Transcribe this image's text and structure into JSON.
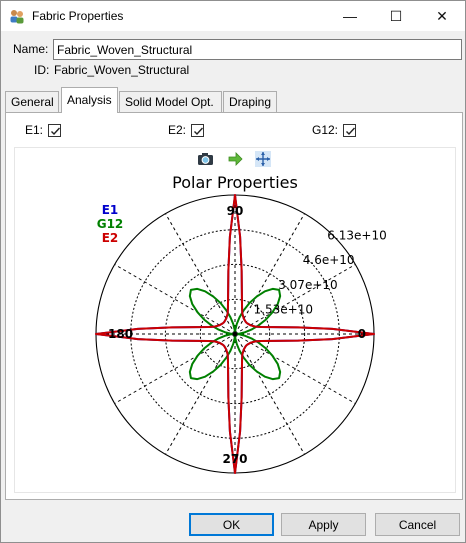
{
  "window": {
    "title": "Fabric Properties",
    "minimize_glyph": "—",
    "maximize_glyph": "☐",
    "close_glyph": "✕"
  },
  "form": {
    "name_label": "Name:",
    "name_value": "Fabric_Woven_Structural",
    "id_label": "ID:",
    "id_value": "Fabric_Woven_Structural"
  },
  "tabs": [
    {
      "label": "General",
      "active": false
    },
    {
      "label": "Analysis",
      "active": true
    },
    {
      "label": "Solid Model Opt.",
      "active": false
    },
    {
      "label": "Draping",
      "active": false
    }
  ],
  "checkboxes": [
    {
      "label": "E1:",
      "checked": true
    },
    {
      "label": "E2:",
      "checked": true
    },
    {
      "label": "G12:",
      "checked": true
    }
  ],
  "toolbar_icons": [
    "camera-icon",
    "arrow-right-icon",
    "fit-view-icon"
  ],
  "buttons": {
    "ok": "OK",
    "apply": "Apply",
    "cancel": "Cancel"
  },
  "chart_data": {
    "type": "polar",
    "title": "Polar Properties",
    "legend": [
      {
        "name": "E1",
        "color": "#0000cc"
      },
      {
        "name": "G12",
        "color": "#008000"
      },
      {
        "name": "E2",
        "color": "#cc0000"
      }
    ],
    "legend_placement": "top-left",
    "radial_ticks": [
      15300000000.0,
      30700000000.0,
      46000000000.0,
      61300000000.0
    ],
    "radial_tick_labels": [
      "1.53e+10",
      "3.07e+10",
      "4.6e+10",
      "6.13e+10"
    ],
    "r_max": 61300000000.0,
    "angle_labels": [
      "0",
      "90",
      "180",
      "270"
    ],
    "angle_label_degrees": [
      0,
      90,
      180,
      270
    ],
    "spoke_step_deg": 30,
    "grid": true,
    "series": [
      {
        "name": "E2",
        "color": "#cc0000",
        "angles_deg": [
          0,
          3,
          6,
          10,
          15,
          20,
          30,
          40,
          45,
          50,
          60,
          70,
          75,
          80,
          84,
          87,
          90
        ],
        "values": [
          61300000000.0,
          43000000000.0,
          28000000000.0,
          17500000000.0,
          12000000000.0,
          9500000000.0,
          7800000000.0,
          7200000000.0,
          7100000000.0,
          7200000000.0,
          7800000000.0,
          9500000000.0,
          12000000000.0,
          17500000000.0,
          28000000000.0,
          43000000000.0,
          61300000000.0
        ]
      },
      {
        "name": "E1",
        "color": "#0000cc",
        "angles_deg": [
          0,
          3,
          6,
          10,
          15,
          20,
          30,
          40,
          45,
          50,
          60,
          70,
          75,
          80,
          84,
          87,
          90
        ],
        "values": [
          61300000000.0,
          43000000000.0,
          28000000000.0,
          17500000000.0,
          12000000000.0,
          9500000000.0,
          7800000000.0,
          7200000000.0,
          7100000000.0,
          7200000000.0,
          7800000000.0,
          9500000000.0,
          12000000000.0,
          17500000000.0,
          28000000000.0,
          43000000000.0,
          61300000000.0
        ]
      },
      {
        "name": "G12",
        "color": "#008000",
        "angles_deg": [
          0,
          5,
          10,
          15,
          20,
          25,
          30,
          35,
          40,
          45,
          50,
          55,
          60,
          65,
          70,
          75,
          80,
          85,
          90
        ],
        "values": [
          0,
          2000000000.0,
          4500000000.0,
          7500000000.0,
          11000000000.0,
          15000000000.0,
          19000000000.0,
          23000000000.0,
          26000000000.0,
          27500000000.0,
          26000000000.0,
          23000000000.0,
          19000000000.0,
          15000000000.0,
          11000000000.0,
          7500000000.0,
          4500000000.0,
          2000000000.0,
          0
        ]
      }
    ]
  }
}
